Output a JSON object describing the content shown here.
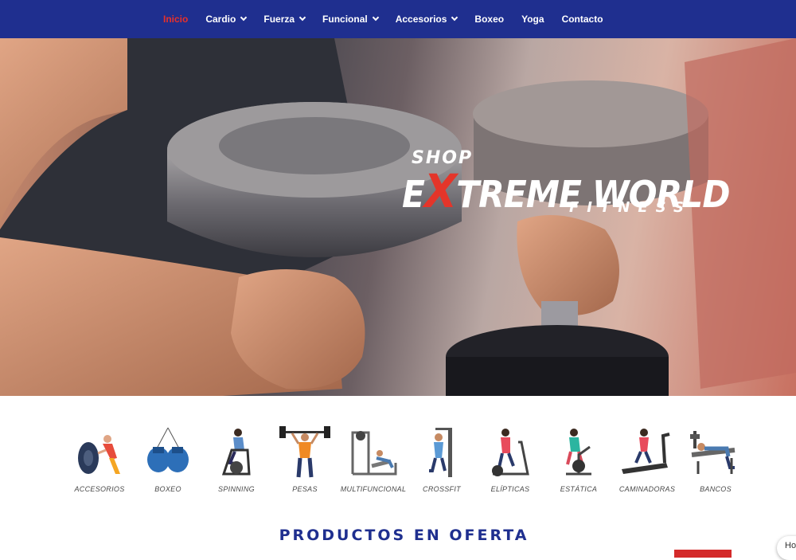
{
  "nav": {
    "items": [
      {
        "label": "Inicio",
        "active": true,
        "dropdown": false
      },
      {
        "label": "Cardio",
        "active": false,
        "dropdown": true
      },
      {
        "label": "Fuerza",
        "active": false,
        "dropdown": true
      },
      {
        "label": "Funcional",
        "active": false,
        "dropdown": true
      },
      {
        "label": "Accesorios",
        "active": false,
        "dropdown": true
      },
      {
        "label": "Boxeo",
        "active": false,
        "dropdown": false
      },
      {
        "label": "Yoga",
        "active": false,
        "dropdown": false
      },
      {
        "label": "Contacto",
        "active": false,
        "dropdown": false
      }
    ],
    "colors": {
      "background": "#1f2f8f",
      "active": "#e8302a",
      "text": "#ffffff"
    }
  },
  "hero": {
    "logo": {
      "shop": "SHOP",
      "main_pre": "E",
      "main_x": "X",
      "main_post": "TREME WORLD",
      "fitness": "FITNESS"
    }
  },
  "categories": [
    {
      "label": "ACCESORIOS",
      "icon": "tire-flip-icon"
    },
    {
      "label": "BOXEO",
      "icon": "boxing-gloves-icon"
    },
    {
      "label": "SPINNING",
      "icon": "spinning-bike-icon"
    },
    {
      "label": "PESAS",
      "icon": "weightlifter-icon"
    },
    {
      "label": "MULTIFUNCIONAL",
      "icon": "multi-gym-icon"
    },
    {
      "label": "CROSSFIT",
      "icon": "crossfit-rig-icon"
    },
    {
      "label": "ELÍPTICAS",
      "icon": "elliptical-icon"
    },
    {
      "label": "ESTÁTICA",
      "icon": "stationary-bike-icon"
    },
    {
      "label": "CAMINADORAS",
      "icon": "treadmill-icon"
    },
    {
      "label": "BANCOS",
      "icon": "bench-press-icon"
    }
  ],
  "section": {
    "title": "PRODUCTOS EN OFERTA"
  },
  "help": {
    "label": "Ho"
  },
  "colors": {
    "accent_red": "#e4352a",
    "brand_blue": "#1f2f8f"
  }
}
